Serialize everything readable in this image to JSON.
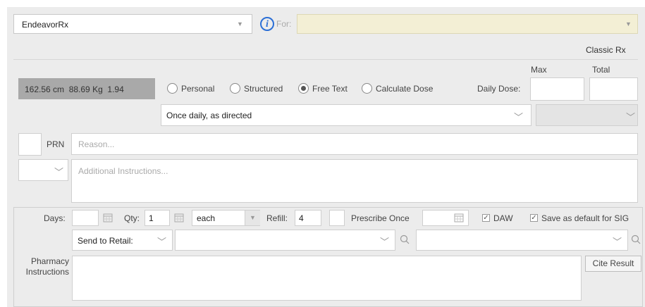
{
  "drug": {
    "value": "EndeavorRx"
  },
  "for": {
    "label": "For:"
  },
  "classic_rx": "Classic Rx",
  "patient_stats": "162.56 cm  88.69 Kg  1.94",
  "dose_modes": [
    {
      "label": "Personal",
      "selected": false
    },
    {
      "label": "Structured",
      "selected": false
    },
    {
      "label": "Free Text",
      "selected": true
    },
    {
      "label": "Calculate Dose",
      "selected": false
    }
  ],
  "daily_dose": {
    "label": "Daily Dose:",
    "max_label": "Max",
    "total_label": "Total"
  },
  "sig": {
    "value": "Once daily, as directed"
  },
  "prn": {
    "label": "PRN",
    "reason_placeholder": "Reason..."
  },
  "additional": {
    "placeholder": "Additional Instructions..."
  },
  "dispense": {
    "days_label": "Days:",
    "qty_label": "Qty:",
    "qty_value": "1",
    "unit": "each",
    "refill_label": "Refill:",
    "refill_value": "4",
    "prescribe_once_label": "Prescribe Once",
    "daw_label": "DAW",
    "save_default_label": "Save as default for SIG"
  },
  "send_to": {
    "value": "Send to Retail:"
  },
  "pharmacy": {
    "label_line1": "Pharmacy",
    "label_line2": "Instructions"
  },
  "cite_result": "Cite Result"
}
